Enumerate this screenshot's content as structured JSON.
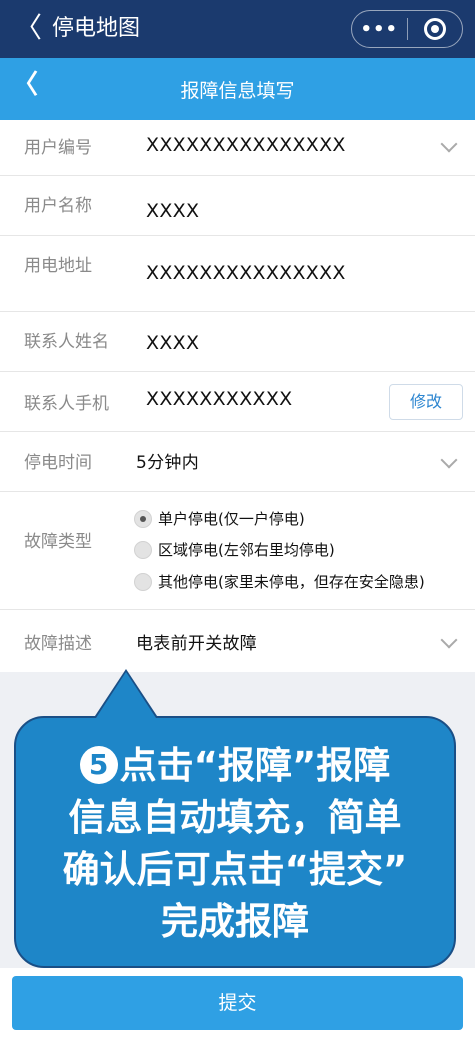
{
  "top_bar": {
    "back": "〈",
    "title": "停电地图",
    "menu_dots": "•••"
  },
  "nav_bar": {
    "back": "〈",
    "title": "报障信息填写"
  },
  "form": {
    "user_no": {
      "label": "用户编号",
      "value": "XXXXXXXXXXXXXXX"
    },
    "user_name": {
      "label": "用户名称",
      "value": "XXXX"
    },
    "address": {
      "label": "用电地址",
      "value": "XXXXXXXXXXXXXXX"
    },
    "contact_name": {
      "label": "联系人姓名",
      "value": "XXXX"
    },
    "contact_phone": {
      "label": "联系人手机",
      "value": "XXXXXXXXXXX",
      "edit": "修改"
    },
    "outage_time": {
      "label": "停电时间",
      "value": "5分钟内"
    },
    "fault_type": {
      "label": "故障类型",
      "options": [
        {
          "text": "单户停电(仅一户停电)",
          "selected": true
        },
        {
          "text": "区域停电(左邻右里均停电)",
          "selected": false
        },
        {
          "text": "其他停电(家里未停电，但存在安全隐患)",
          "selected": false
        }
      ]
    },
    "fault_desc": {
      "label": "故障描述",
      "value": "电表前开关故障"
    }
  },
  "callout": {
    "step": "5",
    "line1": "点击“报障”报障",
    "line2": "信息自动填充，简单",
    "line3": "确认后可点击“提交”",
    "line4": "完成报障"
  },
  "submit": "提交",
  "colors": {
    "top_bar": "#1b3a6e",
    "accent": "#2fa0e4",
    "callout": "#1e86c8"
  }
}
